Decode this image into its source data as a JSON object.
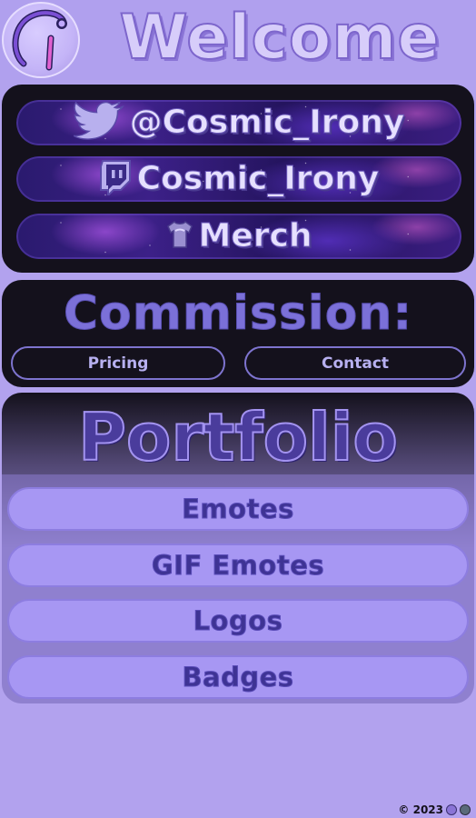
{
  "header": {
    "title": "Welcome",
    "logo_icon": "cosmic-irony-logo-icon"
  },
  "social": {
    "items": [
      {
        "label": "@Cosmic_Irony",
        "icon": "twitter-bird-icon"
      },
      {
        "label": "Cosmic_Irony",
        "icon": "twitch-icon"
      },
      {
        "label": "Merch",
        "icon": "tshirt-icon"
      }
    ]
  },
  "commission": {
    "title": "Commission:",
    "pricing_label": "Pricing",
    "contact_label": "Contact"
  },
  "portfolio": {
    "title": "Portfolio",
    "items": [
      {
        "label": "Emotes"
      },
      {
        "label": "GIF Emotes"
      },
      {
        "label": "Logos"
      },
      {
        "label": "Badges"
      }
    ]
  },
  "footer": {
    "copyright": "© 2023"
  },
  "colors": {
    "background": "#b2a2ee",
    "panel": "#14111c",
    "accent": "#7b70d8",
    "button": "#a797f3"
  }
}
